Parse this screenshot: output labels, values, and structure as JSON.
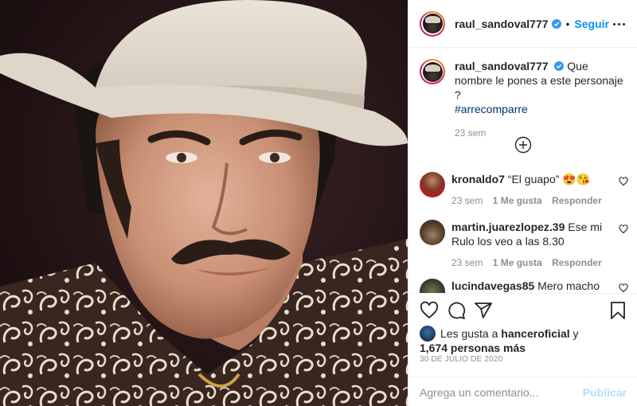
{
  "header": {
    "username": "raul_sandoval777",
    "separator": "•",
    "follow_label": "Seguir",
    "verified_icon": "verified-badge-icon",
    "more_icon": "more-options-icon"
  },
  "caption": {
    "username": "raul_sandoval777",
    "text": "Que nombre le pones a este personaje ?",
    "hashtag": "#arrecomparre",
    "time": "23 sem"
  },
  "load_more_icon": "plus-circle-icon",
  "comments": [
    {
      "username": "kronaldo7",
      "text": "“El guapo” 😍😘",
      "time": "23 sem",
      "likes": "1 Me gusta",
      "reply": "Responder"
    },
    {
      "username": "martin.juarezlopez.39",
      "text": "Ese mi Rulo los veo a las 8.30",
      "time": "23 sem",
      "likes": "1 Me gusta",
      "reply": "Responder"
    },
    {
      "username": "lucindavegas85",
      "text": "Mero macho",
      "time": "",
      "likes": "",
      "reply": ""
    }
  ],
  "actions": {
    "like_icon": "heart-icon",
    "comment_icon": "comment-icon",
    "share_icon": "share-icon",
    "save_icon": "bookmark-icon"
  },
  "likes": {
    "prefix": "Les gusta a",
    "user": "hanceroficial",
    "joiner": "y",
    "count": "1,674 personas más"
  },
  "date": "30 DE JULIO DE 2020",
  "composer": {
    "placeholder": "Agrega un comentario...",
    "post_label": "Publicar"
  },
  "colors": {
    "accent": "#0095f6",
    "verified": "#3897f0",
    "muted": "#8e8e8e",
    "post_disabled": "#b2dffc"
  }
}
